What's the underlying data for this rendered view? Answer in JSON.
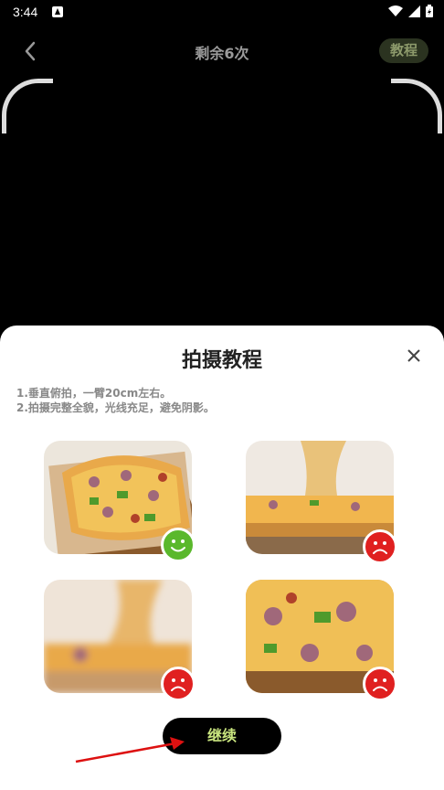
{
  "status_bar": {
    "time": "3:44"
  },
  "header": {
    "title": "剩余6次",
    "tutorial_label": "教程"
  },
  "sheet": {
    "title": "拍摄教程",
    "instructions": [
      "1.垂直俯拍，一臂20cm左右。",
      "2.拍摄完整全貌，光线充足，避免阴影。"
    ],
    "continue_label": "继续"
  },
  "examples": [
    {
      "status": "good",
      "icon": "happy-face-icon"
    },
    {
      "status": "bad",
      "icon": "sad-face-icon"
    },
    {
      "status": "bad",
      "icon": "sad-face-icon"
    },
    {
      "status": "bad",
      "icon": "sad-face-icon"
    }
  ],
  "colors": {
    "good": "#5ab82c",
    "bad": "#e02020",
    "accent": "#c9e57f"
  }
}
